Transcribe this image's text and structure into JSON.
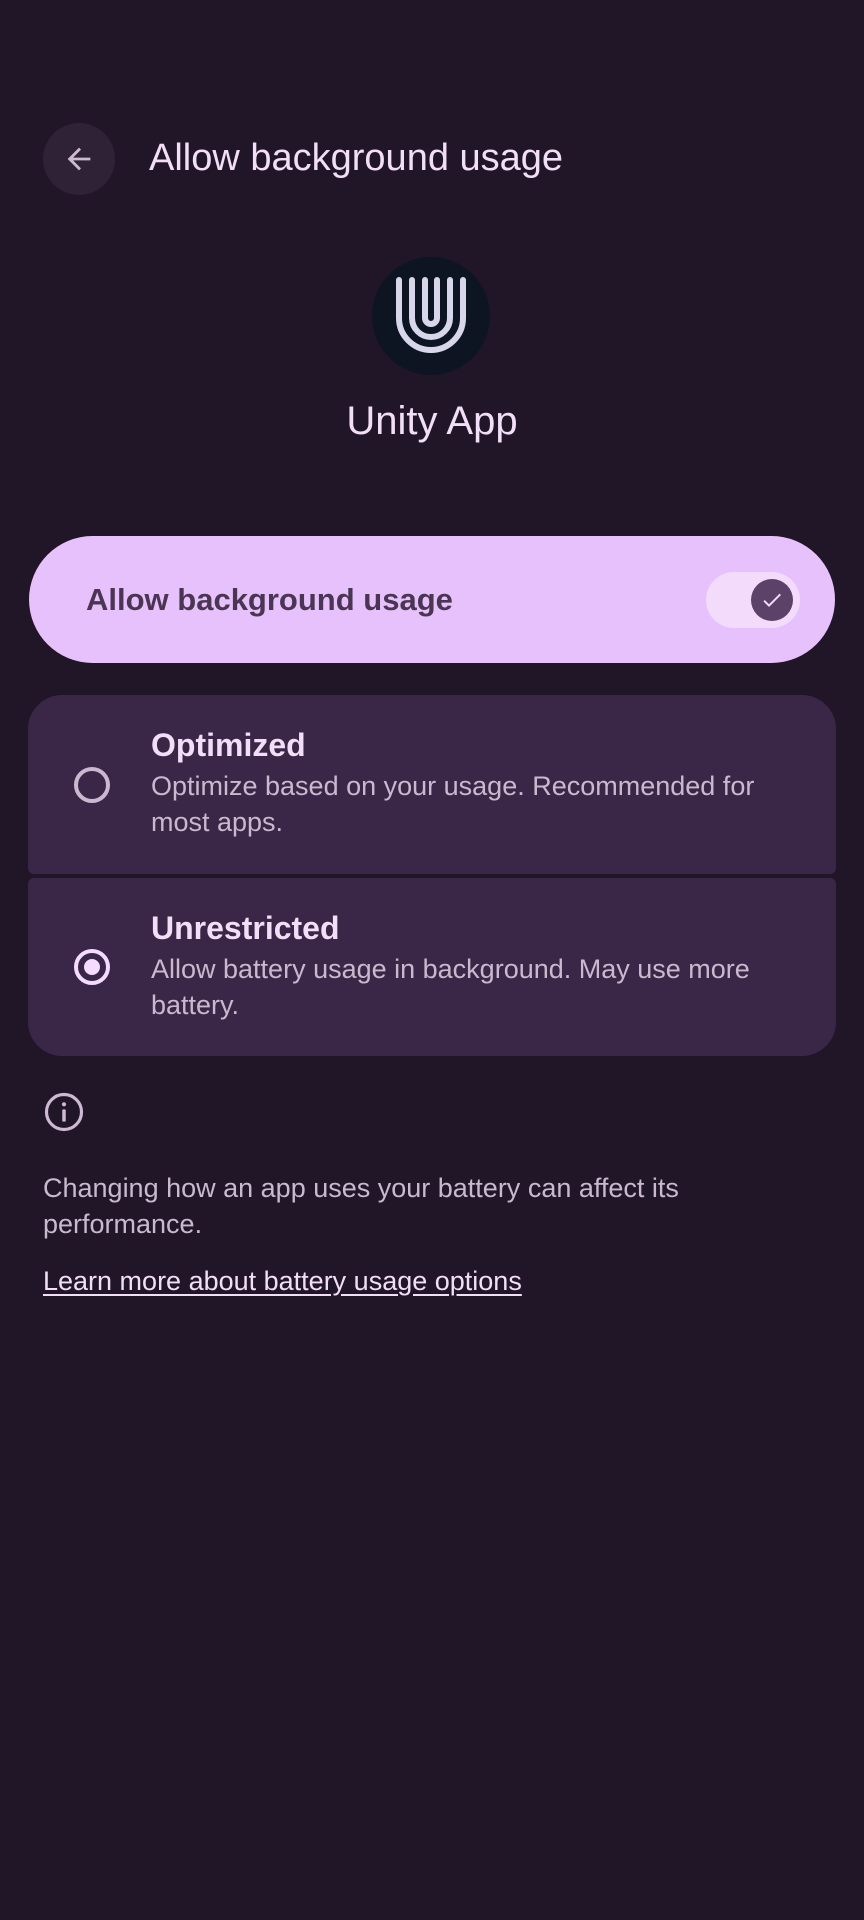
{
  "header": {
    "back_icon": "arrow-back-icon",
    "title": "Allow background usage"
  },
  "app": {
    "icon": "unity-logo-icon",
    "name": "Unity App"
  },
  "toggle": {
    "label": "Allow background usage",
    "checked": true,
    "icon": "check-icon"
  },
  "options": [
    {
      "title": "Optimized",
      "description": "Optimize based on your usage. Recommended for most apps.",
      "selected": false
    },
    {
      "title": "Unrestricted",
      "description": "Allow battery usage in background. May use more battery.",
      "selected": true
    }
  ],
  "footer": {
    "info_icon": "info-icon",
    "text": "Changing how an app uses your battery can affect its performance.",
    "link": "Learn more about battery usage options"
  },
  "colors": {
    "background": "#211528",
    "toggle_card": "#e7c1fb",
    "option_card": "#3a2748",
    "primary_text": "#f2def6",
    "secondary_text": "#c9b9cf"
  }
}
